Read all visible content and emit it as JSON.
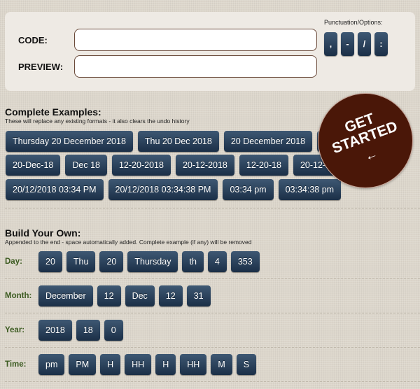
{
  "top": {
    "code_label": "CODE:",
    "preview_label": "PREVIEW:",
    "code_value": "",
    "preview_value": "",
    "punctuation_label": "Punctuation/Options:",
    "punctuation": [
      ",",
      "-",
      "/",
      ":"
    ]
  },
  "complete": {
    "title": "Complete Examples:",
    "subtitle": "These will replace any existing formats - it also clears the undo history",
    "rows": [
      [
        "Thursday 20 December 2018",
        "Thu 20 Dec 2018",
        "20 December 2018",
        "20 D"
      ],
      [
        "20-Dec-18",
        "Dec 18",
        "12-20-2018",
        "20-12-2018",
        "12-20-18",
        "20-12-18",
        ""
      ],
      [
        "20/12/2018 03:34 PM",
        "20/12/2018 03:34:38 PM",
        "03:34 pm",
        "03:34:38 pm"
      ]
    ]
  },
  "build": {
    "title": "Build Your Own:",
    "subtitle": "Appended to the end - space automatically added. Complete example (if any) will be removed",
    "groups": [
      {
        "label": "Day:",
        "items": [
          "20",
          "Thu",
          "20",
          "Thursday",
          "th",
          "4",
          "353"
        ]
      },
      {
        "label": "Month:",
        "items": [
          "December",
          "12",
          "Dec",
          "12",
          "31"
        ]
      },
      {
        "label": "Year:",
        "items": [
          "2018",
          "18",
          "0"
        ]
      },
      {
        "label": "Time:",
        "items": [
          "pm",
          "PM",
          "H",
          "HH",
          "H",
          "HH",
          "M",
          "S"
        ]
      }
    ]
  },
  "cta": {
    "line1": "GET",
    "line2": "STARTED",
    "arrow": "←"
  }
}
